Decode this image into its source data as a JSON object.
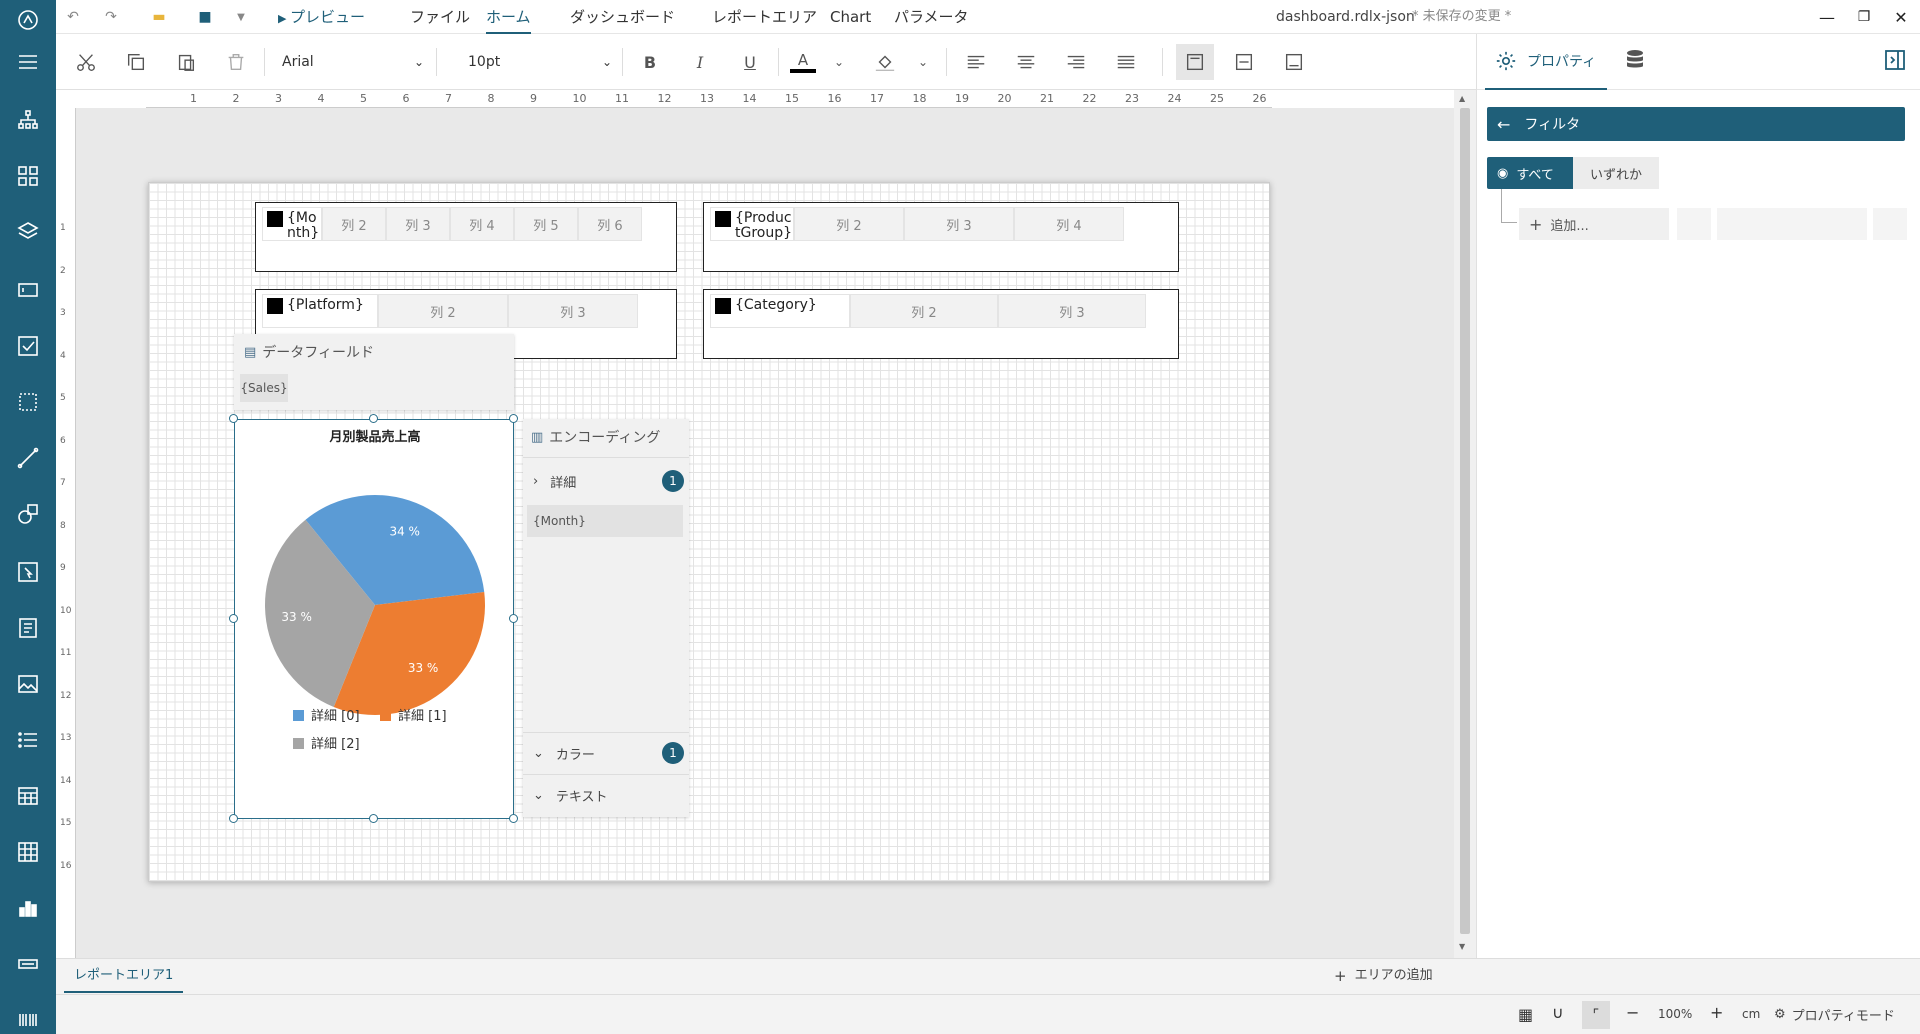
{
  "app": {
    "file_name": "dashboard.rdlx-json",
    "unsaved": "* 未保存の変更 *"
  },
  "menu": {
    "preview": "プレビュー",
    "items": [
      "ファイル",
      "ホーム",
      "ダッシュボード",
      "レポートエリア",
      "Chart",
      "パラメータ"
    ],
    "active_index": 1
  },
  "toolbar": {
    "font_family": "Arial",
    "font_size": "10pt",
    "bold": "B",
    "italic": "I",
    "underline": "U",
    "font_color_letter": "A"
  },
  "ruler": {
    "ticks": [
      "1",
      "2",
      "3",
      "4",
      "5",
      "6",
      "7",
      "8",
      "9",
      "10",
      "11",
      "12",
      "13",
      "14",
      "15",
      "16",
      "17",
      "18",
      "19",
      "20",
      "21",
      "22",
      "23",
      "24",
      "25",
      "26"
    ],
    "vticks": [
      "1",
      "2",
      "3",
      "4",
      "5",
      "6",
      "7",
      "8",
      "9",
      "10",
      "11",
      "12",
      "13",
      "14",
      "15",
      "16"
    ]
  },
  "tables": [
    {
      "field": "{Month}",
      "cols": [
        "列 2",
        "列 3",
        "列 4",
        "列 5",
        "列 6"
      ]
    },
    {
      "field": "{ProductGroup}",
      "cols": [
        "列 2",
        "列 3",
        "列 4"
      ]
    },
    {
      "field": "{Platform}",
      "cols": [
        "列 2",
        "列 3"
      ]
    },
    {
      "field": "{Category}",
      "cols": [
        "列 2",
        "列 3"
      ]
    }
  ],
  "data_fields": {
    "title": "データフィールド",
    "value": "{Sales}"
  },
  "encoding": {
    "title": "エンコーディング",
    "details_label": "詳細",
    "details_count": "1",
    "details_value": "{Month}",
    "color_label": "カラー",
    "color_count": "1",
    "text_label": "テキスト"
  },
  "chart_data": {
    "type": "pie",
    "title": "月別製品売上高",
    "categories": [
      "詳細 [0]",
      "詳細 [1]",
      "詳細 [2]"
    ],
    "values": [
      34,
      33,
      33
    ],
    "labels": [
      "34 %",
      "33 %",
      "33 %"
    ],
    "colors": [
      "#5b9bd5",
      "#ed7d31",
      "#a5a5a5"
    ],
    "legend": "bottom"
  },
  "rpanel": {
    "tab_properties": "プロパティ",
    "filter_title": "フィルタ",
    "seg_all": "すべて",
    "seg_any": "いずれか",
    "add": "追加..."
  },
  "bottom": {
    "tab": "レポートエリア1",
    "add_area": "エリアの追加",
    "zoom": "100%",
    "unit": "cm",
    "prop_mode": "プロパティモード"
  }
}
